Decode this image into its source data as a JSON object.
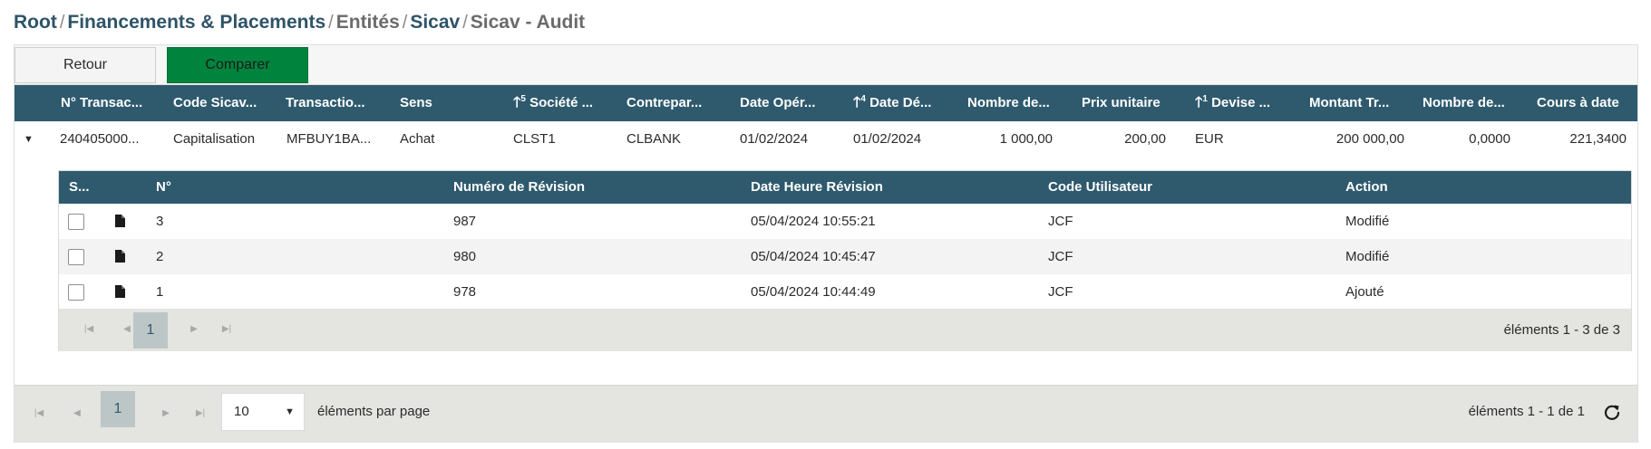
{
  "breadcrumb": {
    "items": [
      "Root",
      "Financements & Placements",
      "Entités",
      "Sicav",
      "Sicav - Audit"
    ],
    "separator": "/"
  },
  "toolbar": {
    "back_label": "Retour",
    "compare_label": "Comparer"
  },
  "grid": {
    "columns": [
      {
        "label": "N° Transac..."
      },
      {
        "label": "Code Sicav..."
      },
      {
        "label": "Transactio..."
      },
      {
        "label": "Sens"
      },
      {
        "label": "Société ...",
        "sort_order": "5"
      },
      {
        "label": "Contrepar..."
      },
      {
        "label": "Date Opér..."
      },
      {
        "label": "Date Dé...",
        "sort_order": "4"
      },
      {
        "label": "Nombre de..."
      },
      {
        "label": "Prix unitaire"
      },
      {
        "label": "Devise ...",
        "sort_order": "1"
      },
      {
        "label": "Montant Tr..."
      },
      {
        "label": "Nombre de..."
      },
      {
        "label": "Cours à date"
      }
    ],
    "row": {
      "cells": [
        "240405000...",
        "Capitalisation",
        "MFBUY1BA...",
        "Achat",
        "CLST1",
        "CLBANK",
        "01/02/2024",
        "01/02/2024",
        "1 000,00",
        "200,00",
        "EUR",
        "200 000,00",
        "0,0000",
        "221,3400"
      ]
    }
  },
  "detail": {
    "columns": {
      "select": "S...",
      "num": "N°",
      "revision": "Numéro de Révision",
      "datetime": "Date Heure Révision",
      "user": "Code Utilisateur",
      "action": "Action"
    },
    "rows": [
      {
        "num": "3",
        "revision": "987",
        "datetime": "05/04/2024 10:55:21",
        "user": "JCF",
        "action": "Modifié"
      },
      {
        "num": "2",
        "revision": "980",
        "datetime": "05/04/2024 10:45:47",
        "user": "JCF",
        "action": "Modifié"
      },
      {
        "num": "1",
        "revision": "978",
        "datetime": "05/04/2024 10:44:49",
        "user": "JCF",
        "action": "Ajouté"
      }
    ],
    "pager": {
      "current_page": "1",
      "info": "éléments 1 - 3 de 3"
    }
  },
  "pager": {
    "current_page": "1",
    "page_size": "10",
    "page_size_label": "éléments par page",
    "info": "éléments 1 - 1 de 1"
  },
  "icons": {
    "expand": "caret-down-icon",
    "document": "document-icon",
    "first": "first-page-icon",
    "prev": "previous-page-icon",
    "next": "next-page-icon",
    "last": "last-page-icon",
    "refresh": "refresh-icon"
  },
  "colors": {
    "header": "#2f5a6e",
    "accent_button": "#00843d",
    "pager_background": "#e4e4e0",
    "active_page": "#bdc6c7"
  }
}
